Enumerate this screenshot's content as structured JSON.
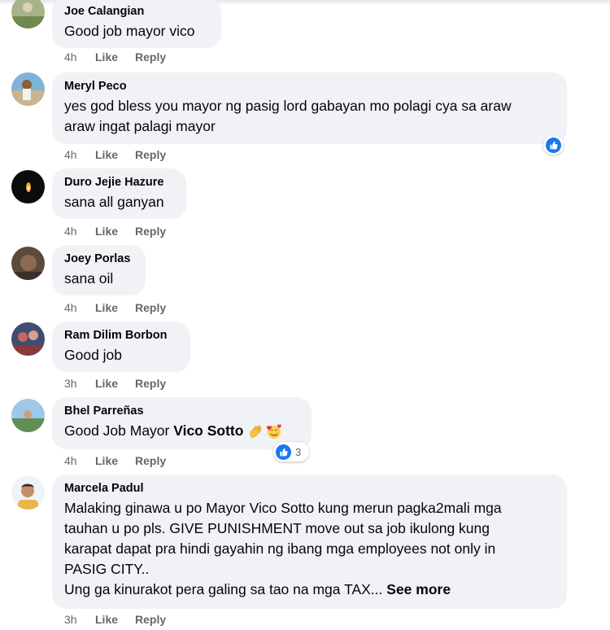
{
  "comments": [
    {
      "name": "Joe Calangian",
      "text": "Good job mayor vico",
      "time": "4h",
      "like": "Like",
      "reply": "Reply"
    },
    {
      "name": "Meryl Peco",
      "text_l1": "yes god bless you mayor ng pasig lord gabayan mo polagi cya sa araw",
      "text_l2": "araw ingat palagi mayor",
      "time": "4h",
      "like": "Like",
      "reply": "Reply"
    },
    {
      "name": "Duro Jejie Hazure",
      "text": "sana all ganyan",
      "time": "4h",
      "like": "Like",
      "reply": "Reply"
    },
    {
      "name": "Joey Porlas",
      "text": "sana oil",
      "time": "4h",
      "like": "Like",
      "reply": "Reply"
    },
    {
      "name": "Ram Dilim Borbon",
      "text": "Good job",
      "time": "3h",
      "like": "Like",
      "reply": "Reply"
    },
    {
      "name": "Bhel Parreñas",
      "text_prefix": "Good Job Mayor ",
      "text_bold": "Vico Sotto",
      "reaction_count": "3",
      "time": "4h",
      "like": "Like",
      "reply": "Reply"
    },
    {
      "name": "Marcela Padul",
      "lines": [
        "Malaking ginawa u po Mayor Vico Sotto kung merun pagka2mali mga",
        "tauhan u po pls. GIVE PUNISHMENT move out sa job ikulong kung",
        "karapat dapat pra hindi gayahin ng ibang mga employees not only in",
        "PASIG CITY..",
        "Ung ga kinurakot pera galing sa tao na mga TAX..."
      ],
      "see_more": "See more",
      "time": "3h",
      "like": "Like",
      "reply": "Reply"
    }
  ],
  "icons": {
    "reaction": "like-reaction-icon",
    "emojis": [
      "clapping-hands-emoji",
      "smiling-face-with-hearts-emoji"
    ]
  },
  "colors": {
    "bubble": "#f0f2f5",
    "meta": "#65676b",
    "like_blue": "#1877f2"
  }
}
